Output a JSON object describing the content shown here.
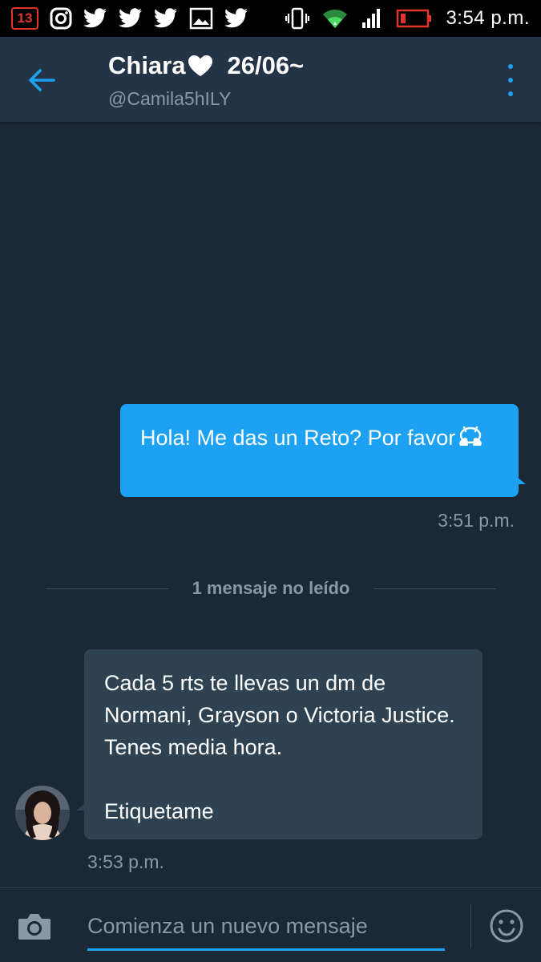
{
  "status_bar": {
    "notification_count": "13",
    "time": "3:54 p.m.",
    "icons": [
      "notification-badge-icon",
      "instagram-icon",
      "twitter-icon",
      "twitter-icon",
      "twitter-icon",
      "image-icon",
      "twitter-icon",
      "vibrate-icon",
      "wifi-icon",
      "signal-icon",
      "battery-icon"
    ],
    "battery_color": "#e0352b"
  },
  "header": {
    "name": "Chiara",
    "date_suffix": "26/06~",
    "handle": "@Camila5hILY"
  },
  "conversation": {
    "sent_message": {
      "text": "Hola! Me das un Reto? Por favor",
      "emoji": "see-no-evil-monkey-icon",
      "time": "3:51 p.m."
    },
    "unread_divider": "1 mensaje no leído",
    "received_message": {
      "paragraph_1": "Cada 5 rts te llevas un dm de Normani, Grayson o Victoria Justice. Tenes media hora.",
      "paragraph_2": "Etiquetame",
      "time": "3:53 p.m."
    }
  },
  "compose": {
    "placeholder": "Comienza un nuevo mensaje"
  },
  "colors": {
    "accent": "#1da1f2",
    "background": "#1b2836",
    "header": "#243447",
    "received_bubble": "#2f4252",
    "muted_text": "#8899a6"
  }
}
